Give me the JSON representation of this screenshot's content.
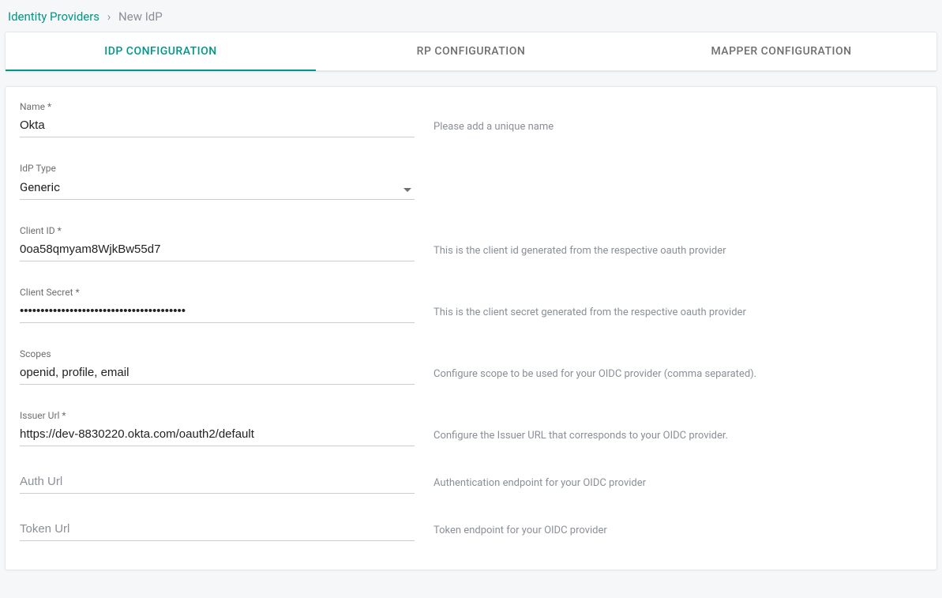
{
  "breadcrumb": {
    "root": "Identity Providers",
    "current": "New IdP"
  },
  "tabs": [
    {
      "id": "idp",
      "label": "IDP CONFIGURATION",
      "active": true
    },
    {
      "id": "rp",
      "label": "RP CONFIGURATION",
      "active": false
    },
    {
      "id": "mapper",
      "label": "MAPPER CONFIGURATION",
      "active": false
    }
  ],
  "form": {
    "name": {
      "label": "Name *",
      "value": "Okta",
      "hint": "Please add a unique name"
    },
    "idp_type": {
      "label": "IdP Type",
      "value": "Generic",
      "hint": ""
    },
    "client_id": {
      "label": "Client ID *",
      "value": "0oa58qmyam8WjkBw55d7",
      "hint": "This is the client id generated from the respective oauth provider"
    },
    "client_secret": {
      "label": "Client Secret *",
      "value": "••••••••••••••••••••••••••••••••••••••••",
      "hint": "This is the client secret generated from the respective oauth provider"
    },
    "scopes": {
      "label": "Scopes",
      "value": "openid, profile, email",
      "hint": "Configure scope to be used for your OIDC provider (comma separated)."
    },
    "issuer_url": {
      "label": "Issuer Url *",
      "value": "https://dev-8830220.okta.com/oauth2/default",
      "hint": "Configure the Issuer URL that corresponds to your OIDC provider."
    },
    "auth_url": {
      "label": "Auth Url",
      "placeholder": "Auth Url",
      "value": "",
      "hint": "Authentication endpoint for your OIDC provider"
    },
    "token_url": {
      "label": "Token Url",
      "placeholder": "Token Url",
      "value": "",
      "hint": "Token endpoint for your OIDC provider"
    }
  }
}
